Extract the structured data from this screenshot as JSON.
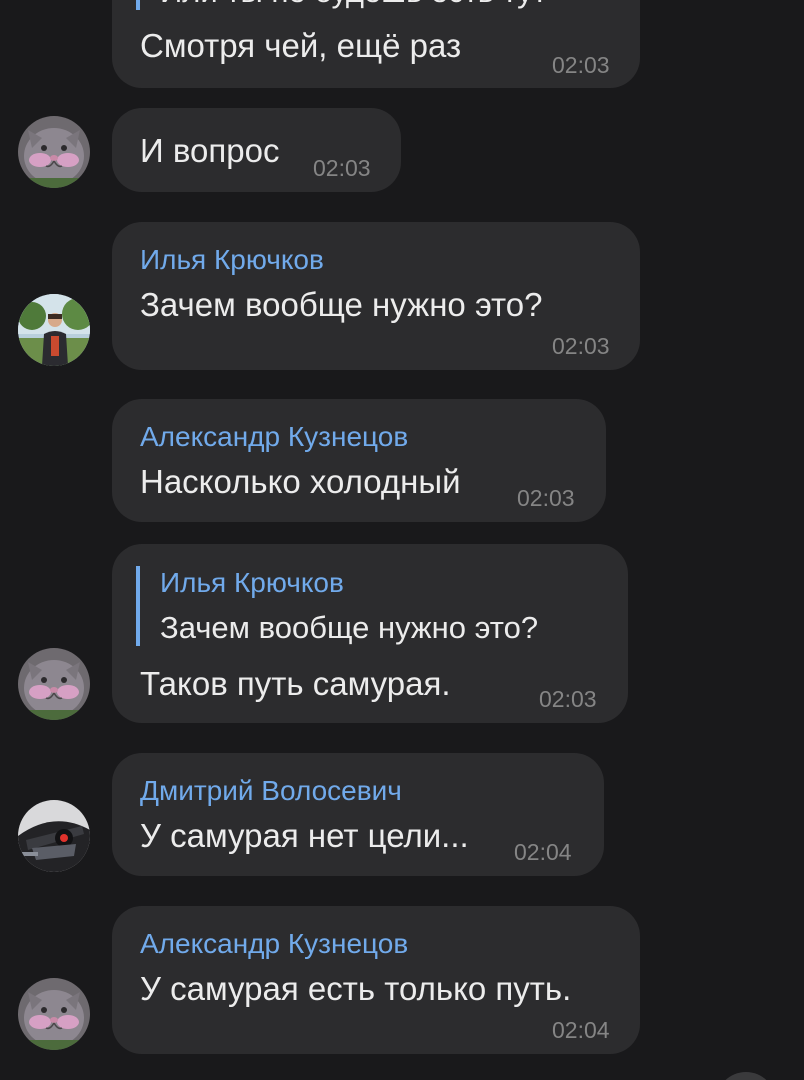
{
  "messages": [
    {
      "id": "m1",
      "quote_partial": "Или ты не будешь есть тут",
      "text": "Смотря чей, ещё раз",
      "time": "02:03"
    },
    {
      "id": "m2",
      "text": "И вопрос",
      "time": "02:03",
      "avatar": "cat-avatar"
    },
    {
      "id": "m3",
      "sender": "Илья Крючков",
      "text": "Зачем вообще нужно это?",
      "time": "02:03",
      "avatar": "person-photo-avatar"
    },
    {
      "id": "m4",
      "sender": "Александр Кузнецов",
      "text": "Насколько холодный",
      "time": "02:03"
    },
    {
      "id": "m5",
      "reply": {
        "sender": "Илья Крючков",
        "text": "Зачем вообще нужно это?"
      },
      "text": "Таков путь самурая.",
      "time": "02:03",
      "avatar": "cat-avatar"
    },
    {
      "id": "m6",
      "sender": "Дмитрий Волосевич",
      "text": "У самурая нет цели...",
      "time": "02:04",
      "avatar": "robot-avatar"
    },
    {
      "id": "m7",
      "sender": "Александр Кузнецов",
      "text": "У самурая есть только путь.",
      "time": "02:04",
      "avatar": "cat-avatar"
    }
  ],
  "colors": {
    "background": "#19191b",
    "bubble": "#2c2c2e",
    "sender_name": "#71aaeb",
    "message_text": "#ececec",
    "timestamp": "#858585"
  }
}
